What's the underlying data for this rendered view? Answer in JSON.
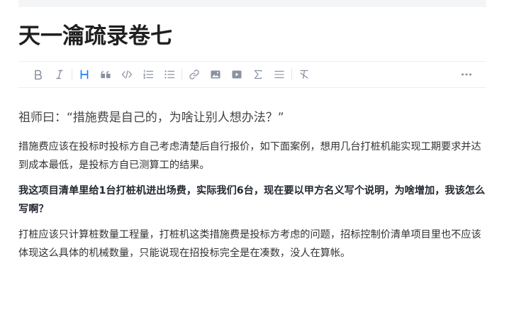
{
  "article": {
    "title": "天一瀹疏录卷七",
    "quote": "祖师曰：“措施费是自己的，为啥让别人想办法？”",
    "paragraphs": [
      "措施费应该在投标时投标方自己考虑清楚后自行报价，如下面案例，想用几台打桩机能实现工期要求并达到成本最低，是投标方自已测算工的结果。",
      "我这项目清单里给1台打桩机进出场费，实际我们6台，现在要以甲方名义写个说明，为啥增加，我该怎么写啊？",
      "打桩应该只计算桩数量工程量，打桩机这类措施费是投标方考虑的问题，招标控制价清单项目里也不应该体现这么具体的机械数量，只能说现在招投标完全是在凑数，没人在算帐。"
    ]
  },
  "toolbar": {
    "icons": [
      "bold-icon",
      "italic-icon",
      "heading-icon",
      "quote-icon",
      "code-icon",
      "ordered-list-icon",
      "unordered-list-icon",
      "link-icon",
      "image-icon",
      "video-icon",
      "formula-icon",
      "divider-icon",
      "clear-format-icon",
      "more-icon"
    ],
    "active_color": "#1e80ff",
    "icon_color": "#8a919f"
  }
}
